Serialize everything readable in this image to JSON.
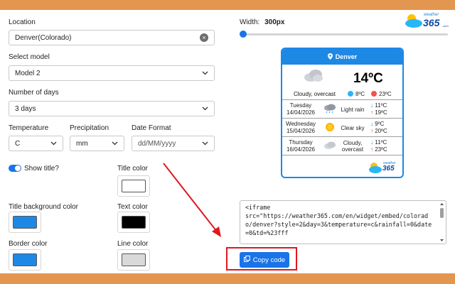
{
  "form": {
    "location_label": "Location",
    "location_value": "Denver(Colorado)",
    "model_label": "Select model",
    "model_value": "Model 2",
    "days_label": "Number of days",
    "days_value": "3 days",
    "temperature_label": "Temperature",
    "temperature_value": "C",
    "precipitation_label": "Precipitation",
    "precipitation_value": "mm",
    "date_format_label": "Date Format",
    "date_format_value": "dd/MM/yyyy",
    "show_title_label": "Show title?",
    "show_title_enabled": true,
    "title_color_label": "Title color",
    "title_color": "#ffffff",
    "title_bg_label": "Title background color",
    "title_bg_color": "#1e88e5",
    "text_color_label": "Text color",
    "text_color": "#000000",
    "border_color_label": "Border color",
    "border_color": "#1e88e5",
    "line_color_label": "Line color",
    "line_color": "#d9d9d9"
  },
  "width_control": {
    "label": "Width:",
    "value": "300px",
    "slider_fraction": 0.0
  },
  "logo": {
    "top": "weather",
    "main": "365",
    "suffix": ".com"
  },
  "widget": {
    "city": "Denver",
    "current_temp": "14ºC",
    "current_condition": "Cloudy, overcast",
    "current_low": "8ºC",
    "current_high": "23ºC",
    "forecast": [
      {
        "day": "Tuesday",
        "date": "14/04/2026",
        "icon": "rain-cloud-icon",
        "condition": "Light rain",
        "low": "11ºC",
        "high": "19ºC"
      },
      {
        "day": "Wednesday",
        "date": "15/04/2026",
        "icon": "sun-icon",
        "condition": "Clear sky",
        "low": "9ºC",
        "high": "20ºC"
      },
      {
        "day": "Thursday",
        "date": "16/04/2026",
        "icon": "cloud-icon",
        "condition": "Cloudy, overcast",
        "low": "11ºC",
        "high": "23ºC"
      }
    ],
    "footer_logo_top": "weather",
    "footer_logo_main": "365"
  },
  "embed": {
    "code": "<iframe\nsrc=\"https://weather365.com/en/widget/embed/colorado/denver?style=2&day=3&temperature=c&rainfall=0&date=0&td=%23fff",
    "copy_label": "Copy code"
  },
  "colors": {
    "accent": "#1a73e8",
    "page_frame": "#e39650",
    "highlight": "#e0171f"
  }
}
